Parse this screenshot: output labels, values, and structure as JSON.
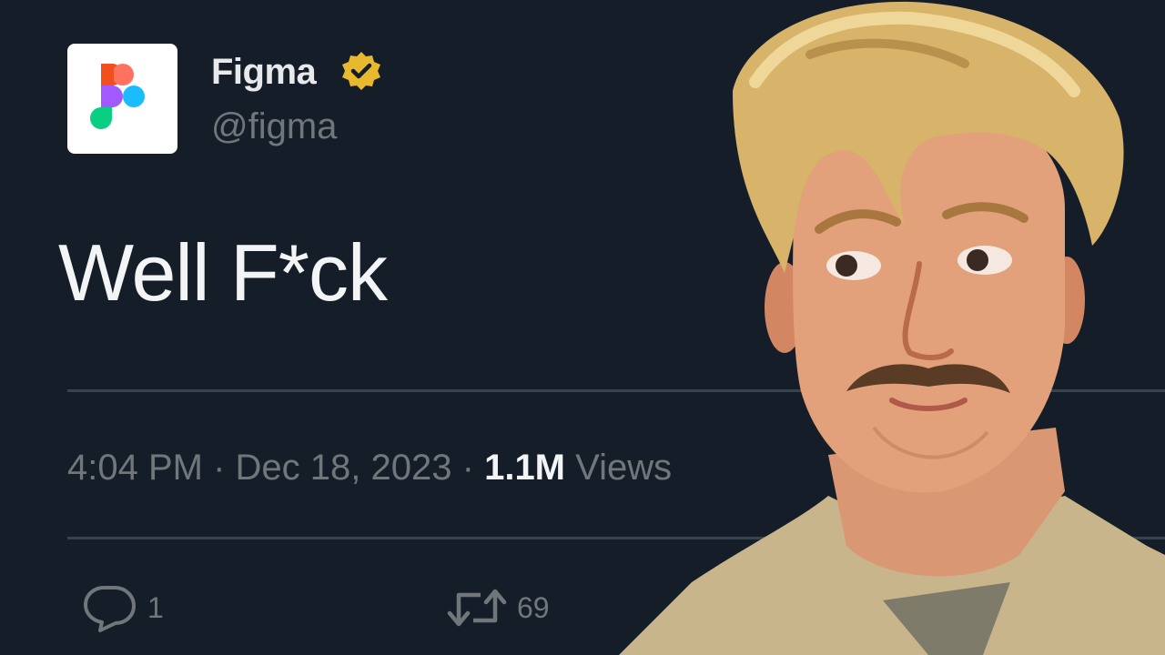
{
  "account": {
    "display_name": "Figma",
    "handle": "@figma",
    "avatar_icon": "figma-logo-icon",
    "verified_icon": "verified-badge-icon",
    "brand_colors": {
      "red": "#f24e1e",
      "orange": "#ff7262",
      "purple": "#a259ff",
      "blue": "#1abcfe",
      "green": "#0acf83"
    },
    "verified_color": "#e8b92f"
  },
  "tweet": {
    "text": "Well F*ck",
    "time": "4:04 PM",
    "separator": "·",
    "date": "Dec 18, 2023",
    "views_count": "1.1M",
    "views_label": "Views"
  },
  "actions": {
    "reply": {
      "icon": "reply-icon",
      "count": "1"
    },
    "retweet": {
      "icon": "retweet-icon",
      "count": "69"
    }
  },
  "colors": {
    "background": "#151d28",
    "muted_text": "#71767b",
    "divider": "#38444d"
  }
}
